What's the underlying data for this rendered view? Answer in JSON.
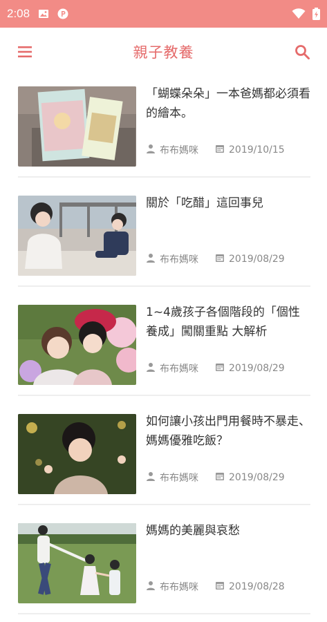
{
  "status_bar": {
    "time": "2:08",
    "icons": [
      "image-icon",
      "parking-p-icon",
      "wifi-icon",
      "battery-icon"
    ]
  },
  "app_bar": {
    "title": "親子教養",
    "menu_icon": "menu-icon",
    "search_icon": "search-icon"
  },
  "articles": [
    {
      "title": "「蝴蝶朵朵」一本爸媽都必須看的繪本。",
      "author": "布布媽咪",
      "date": "2019/10/15"
    },
    {
      "title": "關於「吃醋」這回事兒",
      "author": "布布媽咪",
      "date": "2019/08/29"
    },
    {
      "title": "1~4歲孩子各個階段的「個性養成」闖關重點 大解析",
      "author": "布布媽咪",
      "date": "2019/08/29"
    },
    {
      "title": "如何讓小孩出門用餐時不暴走、媽媽優雅吃飯？",
      "author": "布布媽咪",
      "date": "2019/08/29"
    },
    {
      "title": "媽媽的美麗與哀愁",
      "author": "布布媽咪",
      "date": "2019/08/28"
    }
  ],
  "colors": {
    "status_bar": "#f28b86",
    "accent": "#e56b6b",
    "meta_text": "#888888"
  }
}
